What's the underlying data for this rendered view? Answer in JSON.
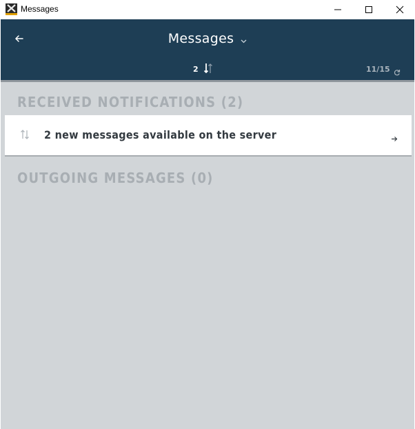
{
  "window": {
    "title": "Messages",
    "app_icon": "app-logo-icon",
    "controls": [
      "minimize-icon",
      "maximize-icon",
      "close-icon"
    ]
  },
  "header": {
    "title": "Messages",
    "title_caret_icon": "chevron-down-icon",
    "back_icon": "arrow-left-icon",
    "sync_count": "2",
    "sync_icon": "sync-arrows-icon",
    "page_counter": "11/15",
    "refresh_icon": "refresh-icon"
  },
  "received": {
    "heading": "RECEIVED NOTIFICATIONS (2)",
    "items": [
      {
        "icon": "transfer-arrows-icon",
        "text": "2 new messages available on the server",
        "action_icon": "arrow-right-icon"
      }
    ]
  },
  "outgoing": {
    "heading": "OUTGOING MESSAGES (0)"
  },
  "colors": {
    "header_bg": "#1e3e55",
    "content_bg": "#d1d5d8",
    "card_bg": "#ffffff",
    "heading_text": "#a8aeb3",
    "card_text": "#333a40"
  }
}
